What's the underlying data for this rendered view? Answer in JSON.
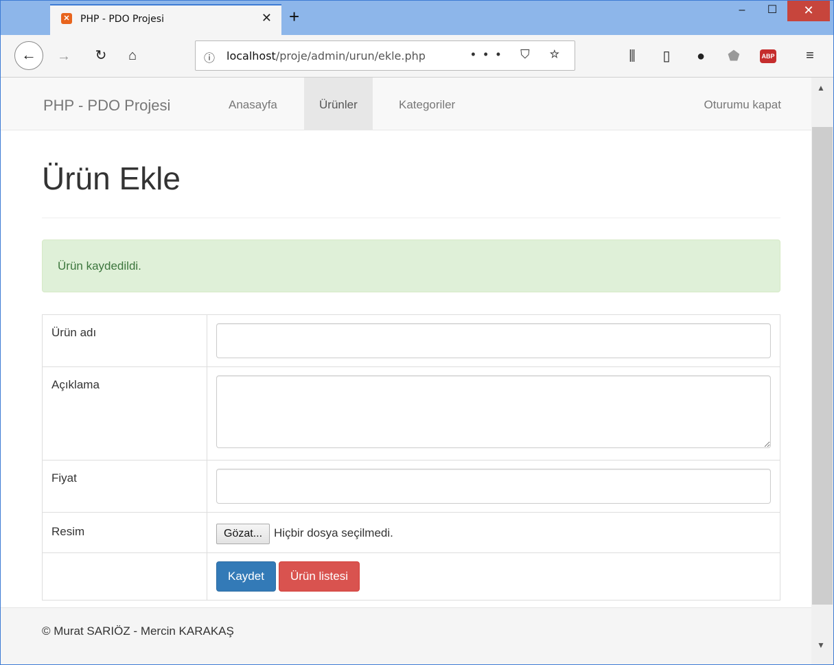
{
  "browser": {
    "tab_title": "PHP - PDO Projesi",
    "tab_close": "✕",
    "new_tab": "+",
    "url_host": "localhost",
    "url_path": "/proje/admin/urun/ekle.php",
    "url_actions": "•••  ⛉  ☆",
    "window_buttons": {
      "minimize": "‒",
      "maximize": "☐",
      "close": "✕"
    },
    "abp_label": "ABP",
    "menu": "≡"
  },
  "navbar": {
    "brand": "PHP - PDO Projesi",
    "items": [
      {
        "label": "Anasayfa",
        "active": false
      },
      {
        "label": "Ürünler",
        "active": true
      },
      {
        "label": "Kategoriler",
        "active": false
      }
    ],
    "right": "Oturumu kapat"
  },
  "page": {
    "title": "Ürün Ekle",
    "alert": "Ürün kaydedildi."
  },
  "form": {
    "name_label": "Ürün adı",
    "name_value": "",
    "desc_label": "Açıklama",
    "desc_value": "",
    "price_label": "Fiyat",
    "price_value": "",
    "image_label": "Resim",
    "file_button": "Gözat...",
    "file_status": "Hiçbir dosya seçilmedi.",
    "save_button": "Kaydet",
    "list_button": "Ürün listesi"
  },
  "footer": {
    "text": "© Murat SARIÖZ - Mercin KARAKAŞ"
  },
  "colors": {
    "primary": "#337ab7",
    "danger": "#d9534f",
    "success_bg": "#dff0d8",
    "success_text": "#3c763d"
  }
}
